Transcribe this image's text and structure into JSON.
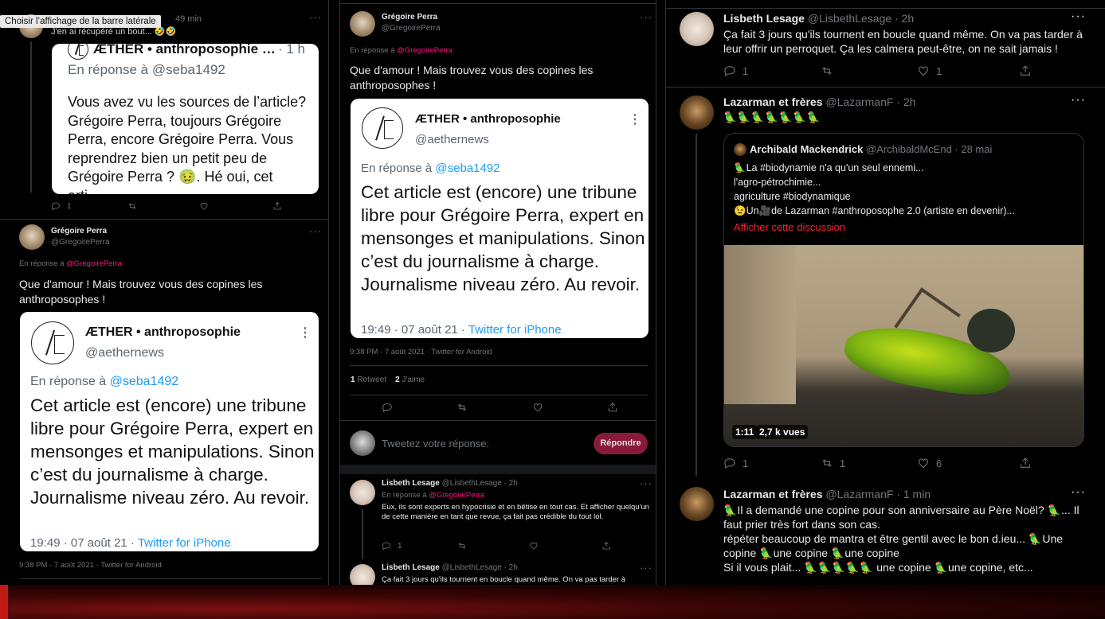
{
  "tooltip": "Choisir l’affichage de la barre latérale",
  "left": {
    "top_tweet": {
      "time": "49 min",
      "partial_text": "J'en ai récupéré un bout... 🤣🤣",
      "replies": "1"
    },
    "card1": {
      "account_name": "ÆTHER • anthroposophie …",
      "time": "· 1 h",
      "reply_prefix": "En réponse à",
      "reply_handle": "@seba1492",
      "text": "Vous avez vu les sources de l’article? Grégoire Perra, toujours Grégoire Perra, encore Grégoire Perra. Vous reprendrez bien un petit peu de Grégoire Perra ? 🤢. Hé oui, cet arti…"
    },
    "tweet": {
      "name": "Grégoire Perra",
      "handle": "@GregoirePerra",
      "reply_prefix": "En réponse à",
      "reply_handle": "@GregoirePerra",
      "text": "Que d'amour ! Mais trouvez vous des copines les anthroposophes !",
      "footer": "9:38 PM · 7 août 2021 · Twitter for Android"
    },
    "card2": {
      "account_name": "ÆTHER • anthroposophie",
      "account_handle": "@aethernews",
      "reply_prefix": "En réponse à",
      "reply_handle": "@seba1492",
      "text": "Cet article est (encore) une tribune libre pour Grégoire Perra, expert en mensonges et manipulations. Sinon c’est du journalisme à charge. Journalisme niveau zéro. Au revoir.",
      "time": "19:49 · 07 août 21 ·",
      "source": "Twitter for iPhone"
    }
  },
  "middle": {
    "tweet": {
      "name": "Grégoire Perra",
      "handle": "@GregoirePerra",
      "reply_prefix": "En réponse à",
      "reply_handle": "@GregoirePerra",
      "text": "Que d'amour ! Mais trouvez vous des copines les anthroposophes !",
      "footer": "9:38 PM · 7 août 2021 · Twitter for Android",
      "retweets_count": "1",
      "retweets_label": "Retweet",
      "likes_count": "2",
      "likes_label": "J'aime"
    },
    "card": {
      "account_name": "ÆTHER • anthroposophie",
      "account_handle": "@aethernews",
      "reply_prefix": "En réponse à",
      "reply_handle": "@seba1492",
      "text": "Cet article est (encore) une tribune libre pour Grégoire Perra, expert en mensonges et manipulations. Sinon c’est du journalisme à charge. Journalisme niveau zéro. Au revoir.",
      "time": "19:49 · 07 août 21 ·",
      "source": "Twitter for iPhone"
    },
    "compose": {
      "placeholder": "Tweetez votre réponse.",
      "button": "Répondre"
    },
    "reply1": {
      "name": "Lisbeth Lesage",
      "handle": "@LisbethLesage · 2h",
      "reply_prefix": "En réponse à",
      "reply_handle": "@GregoirePerra",
      "text": "Eux, ils sont experts en hypocrisie et en bêtise en tout cas. Et afficher quelqu'un de cette manière en tant que revue, ça fait pas crédible du tout lol.",
      "replies": "1"
    },
    "reply2": {
      "name": "Lisbeth Lesage",
      "handle": "@LisbethLesage · 2h",
      "text": "Ça fait 3 jours qu'ils tournent en boucle quand même. On va pas tarder à"
    }
  },
  "right": {
    "tweet1": {
      "name": "Lisbeth Lesage",
      "handle": "@LisbethLesage · 2h",
      "text": "Ça fait 3 jours qu'ils tournent en boucle quand même. On va pas tarder à leur offrir un perroquet. Ça les calmera peut-être, on ne sait jamais !",
      "replies": "1",
      "likes": "1"
    },
    "tweet2": {
      "name": "Lazarman et frères",
      "handle": "@LazarmanF · 2h",
      "text": "🦜🦜🦜🦜🦜🦜🦜",
      "quote": {
        "name": "Archibald Mackendrick",
        "handle": "@ArchibaldMcEnd · 28 mai",
        "line1": "🦜La #biodynamie n'a qu'un seul ennemi...",
        "line2": "l'agro-pétrochimie...",
        "line3": "agriculture #biodynamique",
        "line4": "😉Un🎥de Lazarman #anthroposophe 2.0 (artiste en devenir)...",
        "show_thread": "Afficher cette discussion",
        "video_duration": "1:11",
        "video_views": "2,7 k vues"
      },
      "replies": "1",
      "retweets": "1",
      "likes": "6"
    },
    "tweet3": {
      "name": "Lazarman et frères",
      "handle": "@LazarmanF · 1 min",
      "line1": "🦜Il a demandé une copine pour son anniversaire au Père Noël? 🦜... Il faut prier très fort dans son cas.",
      "line2": "répéter beaucoup de mantra et être gentil avec le bon d.ieu... 🦜Une copine 🦜une copine 🦜une copine",
      "line3": "Si il vous plait... 🦜🦜🦜🦜🦜 une copine 🦜une copine, etc..."
    }
  }
}
